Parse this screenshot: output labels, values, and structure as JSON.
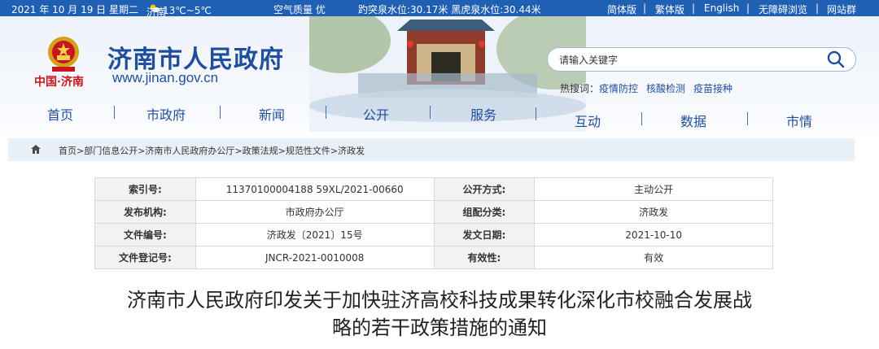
{
  "topbar": {
    "date": "2021 年 10 月 19 日 星期二",
    "city": "济南",
    "weather_icon": "partly-cloudy-icon",
    "temperature": "13℃~5℃",
    "air_quality": "空气质量 优",
    "water_level": "趵突泉水位:30.17米 黑虎泉水位:30.44米",
    "links": [
      "简体版",
      "繁体版",
      "English",
      "无障碍浏览",
      "网站群"
    ]
  },
  "header": {
    "cn_logo": "中国·济南",
    "title": "济南市人民政府",
    "url": "www.jinan.gov.cn",
    "search_placeholder": "请输入关键字",
    "hot_label": "热搜词：",
    "hot_words": [
      "疫情防控",
      "核酸检测",
      "疫苗接种"
    ]
  },
  "nav": [
    "首页",
    "市政府",
    "新闻",
    "公开",
    "服务",
    "互动",
    "数据",
    "市情"
  ],
  "breadcrumb": "首页>部门信息公开>济南市人民政府办公厅>政策法规>规范性文件>济政发",
  "meta": {
    "rows": [
      {
        "k1": "索引号:",
        "v1": "11370100004188 59XL/2021-00660",
        "k2": "公开方式:",
        "v2": "主动公开"
      },
      {
        "k1": "发布机构:",
        "v1": "市政府办公厅",
        "k2": "组配分类:",
        "v2": "济政发"
      },
      {
        "k1": "文件编号:",
        "v1": "济政发〔2021〕15号",
        "k2": "发文日期:",
        "v2": "2021-10-10"
      },
      {
        "k1": "文件登记号:",
        "v1": "JNCR-2021-0010008",
        "k2": "有效性:",
        "v2": "有效"
      }
    ]
  },
  "doc_title": {
    "line1": "济南市人民政府印发关于加快驻济高校科技成果转化深化市校融合发展战",
    "line2": "略的若干政策措施的通知"
  },
  "colors": {
    "accent": "#1f5fb4",
    "title_blue": "#1f4e9c",
    "red": "#c8161d"
  }
}
